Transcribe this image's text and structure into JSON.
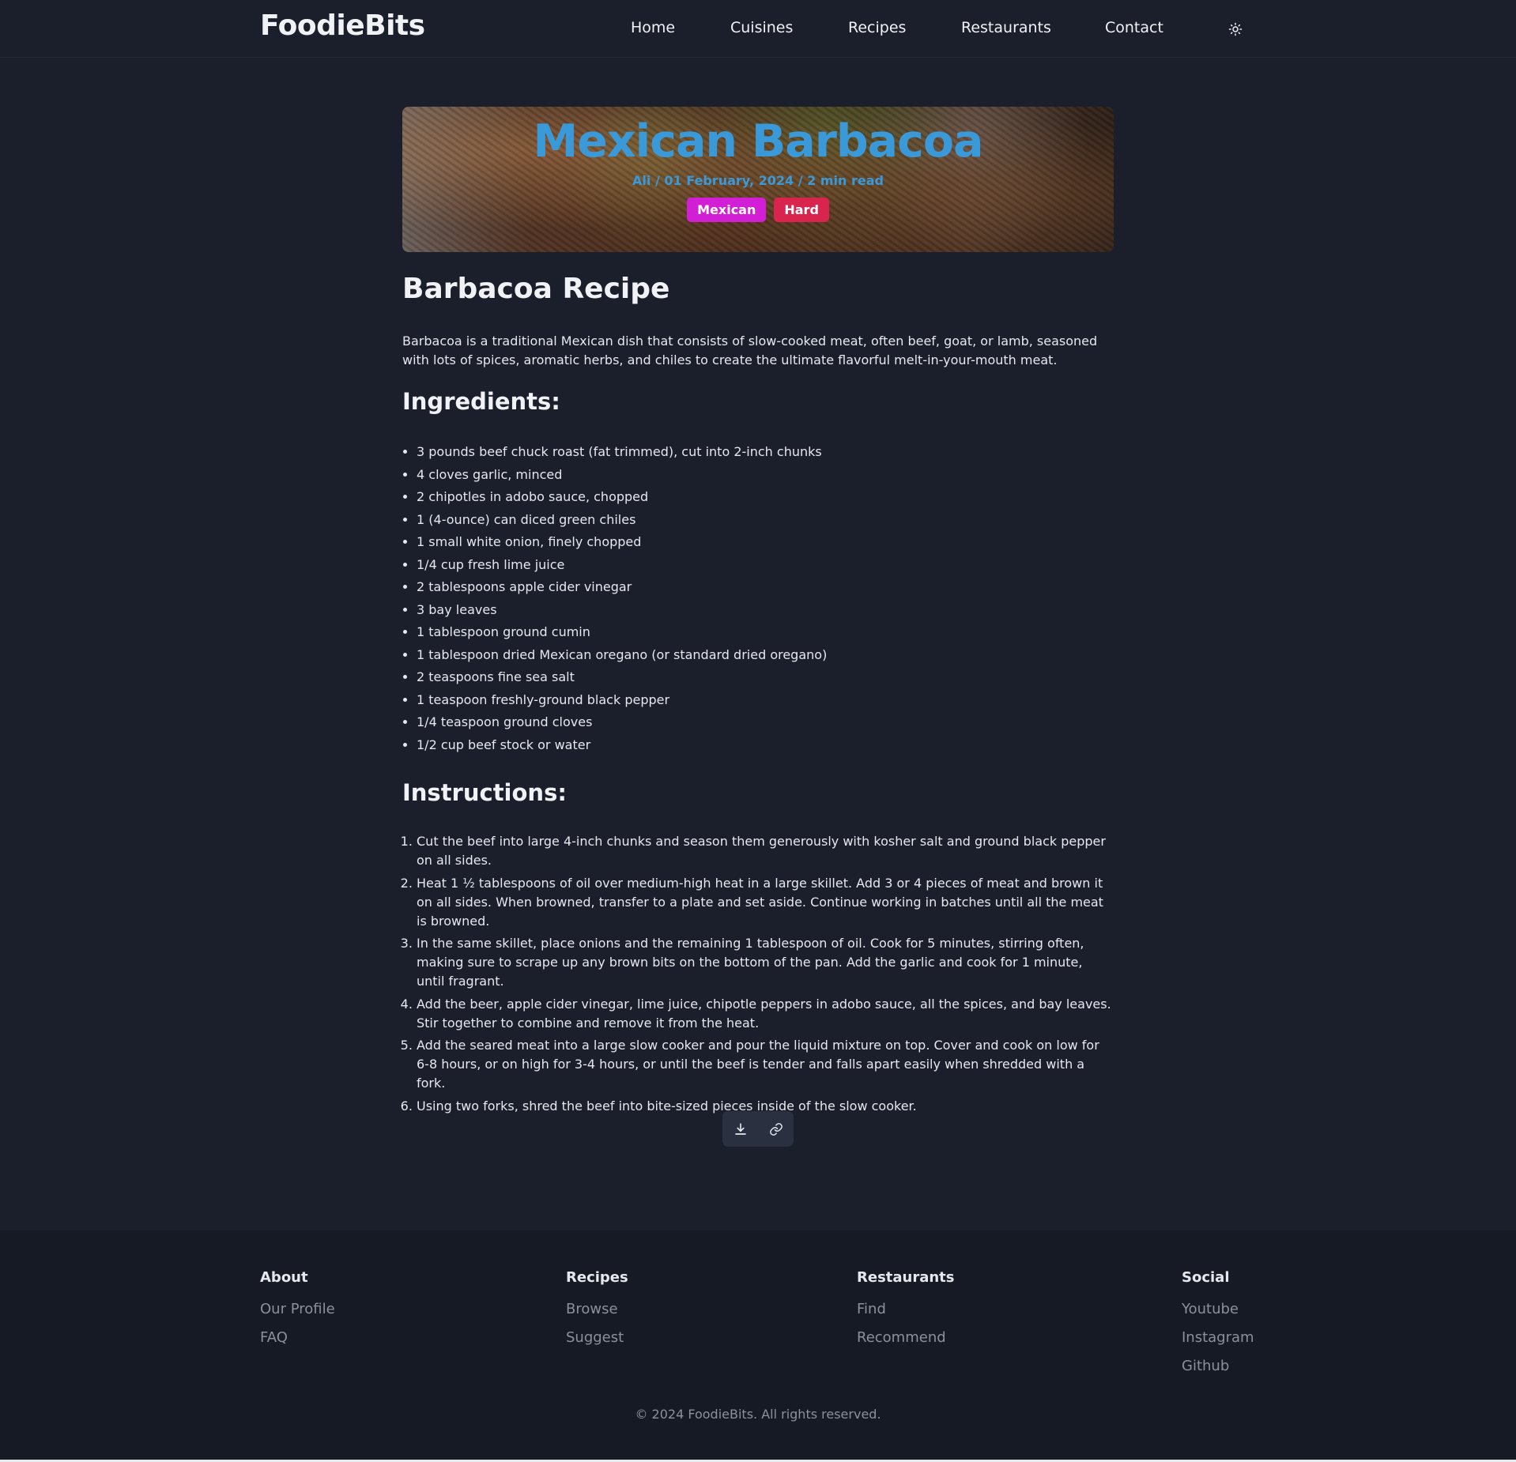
{
  "nav": {
    "brand": "FoodieBits",
    "links": [
      "Home",
      "Cuisines",
      "Recipes",
      "Restaurants",
      "Contact"
    ],
    "theme_icon": "sun-icon"
  },
  "hero": {
    "title": "Mexican Barbacoa",
    "meta": "Ali / 01 February, 2024 / 2 min read",
    "tags": [
      "Mexican",
      "Hard"
    ],
    "title_color": "#3a9ad9",
    "tag_colors": [
      "#d21fd6",
      "#d9244e"
    ]
  },
  "article": {
    "heading": "Barbacoa Recipe",
    "intro": "Barbacoa is a traditional Mexican dish that consists of slow-cooked meat, often beef, goat, or lamb, seasoned with lots of spices, aromatic herbs, and chiles to create the ultimate flavorful melt-in-your-mouth meat.",
    "ingredients_heading": "Ingredients:",
    "ingredients": [
      "3 pounds beef chuck roast (fat trimmed), cut into 2-inch chunks",
      "4 cloves garlic, minced",
      "2 chipotles in adobo sauce, chopped",
      "1 (4-ounce) can diced green chiles",
      "1 small white onion, finely chopped",
      "1/4 cup fresh lime juice",
      "2 tablespoons apple cider vinegar",
      "3 bay leaves",
      "1 tablespoon ground cumin",
      "1 tablespoon dried Mexican oregano (or standard dried oregano)",
      "2 teaspoons fine sea salt",
      "1 teaspoon freshly-ground black pepper",
      "1/4 teaspoon ground cloves",
      "1/2 cup beef stock or water"
    ],
    "instructions_heading": "Instructions:",
    "instructions": [
      "Cut the beef into large 4-inch chunks and season them generously with kosher salt and ground black pepper on all sides.",
      "Heat 1 ½ tablespoons of oil over medium-high heat in a large skillet. Add 3 or 4 pieces of meat and brown it on all sides. When browned, transfer to a plate and set aside. Continue working in batches until all the meat is browned.",
      "In the same skillet, place onions and the remaining 1 tablespoon of oil. Cook for 5 minutes, stirring often, making sure to scrape up any brown bits on the bottom of the pan. Add the garlic and cook for 1 minute, until fragrant.",
      "Add the beer, apple cider vinegar, lime juice, chipotle peppers in adobo sauce, all the spices, and bay leaves. Stir together to combine and remove it from the heat.",
      "Add the seared meat into a large slow cooker and pour the liquid mixture on top. Cover and cook on low for 6-8 hours, or on high for 3-4 hours, or until the beef is tender and falls apart easily when shredded with a fork.",
      "Using two forks, shred the beef into bite-sized pieces inside of the slow cooker."
    ]
  },
  "actions": {
    "download_icon": "download-icon",
    "link_icon": "link-icon"
  },
  "footer": {
    "columns": [
      {
        "title": "About",
        "links": [
          "Our Profile",
          "FAQ"
        ]
      },
      {
        "title": "Recipes",
        "links": [
          "Browse",
          "Suggest"
        ]
      },
      {
        "title": "Restaurants",
        "links": [
          "Find",
          "Recommend"
        ]
      },
      {
        "title": "Social",
        "links": [
          "Youtube",
          "Instagram",
          "Github"
        ]
      }
    ],
    "copyright": "© 2024 FoodieBits. All rights reserved."
  }
}
